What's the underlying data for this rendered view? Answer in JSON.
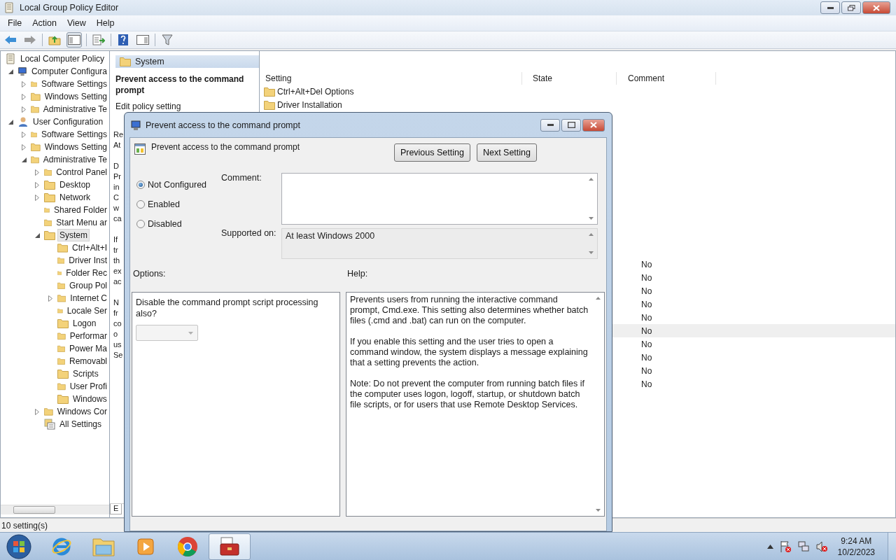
{
  "window": {
    "title": "Local Group Policy Editor"
  },
  "menu": [
    "File",
    "Action",
    "View",
    "Help"
  ],
  "tree": [
    {
      "label": "Local Computer Policy",
      "kind": "root",
      "selected": false,
      "children": [
        {
          "label": "Computer Configura",
          "kind": "computer",
          "expandable": true,
          "expanded": true,
          "selected": false,
          "children": [
            {
              "label": "Software Settings",
              "kind": "folder",
              "expandable": true,
              "expanded": false,
              "selected": false
            },
            {
              "label": "Windows Setting",
              "kind": "folder",
              "expandable": true,
              "expanded": false,
              "selected": false
            },
            {
              "label": "Administrative Te",
              "kind": "folder",
              "expandable": true,
              "expanded": false,
              "selected": false
            }
          ]
        },
        {
          "label": "User Configuration",
          "kind": "user",
          "expandable": true,
          "expanded": true,
          "selected": false,
          "children": [
            {
              "label": "Software Settings",
              "kind": "folder",
              "expandable": true,
              "expanded": false,
              "selected": false
            },
            {
              "label": "Windows Setting",
              "kind": "folder",
              "expandable": true,
              "expanded": false,
              "selected": false
            },
            {
              "label": "Administrative Te",
              "kind": "folder",
              "expandable": true,
              "expanded": true,
              "selected": false,
              "children": [
                {
                  "label": "Control Panel",
                  "kind": "folder",
                  "expandable": true,
                  "expanded": false,
                  "selected": false
                },
                {
                  "label": "Desktop",
                  "kind": "folder",
                  "expandable": true,
                  "expanded": false,
                  "selected": false
                },
                {
                  "label": "Network",
                  "kind": "folder",
                  "expandable": true,
                  "expanded": false,
                  "selected": false
                },
                {
                  "label": "Shared Folder",
                  "kind": "folder",
                  "expandable": false,
                  "expanded": false,
                  "selected": false
                },
                {
                  "label": "Start Menu ar",
                  "kind": "folder",
                  "expandable": false,
                  "expanded": false,
                  "selected": false
                },
                {
                  "label": "System",
                  "kind": "folder",
                  "expandable": true,
                  "expanded": true,
                  "selected": true,
                  "children": [
                    {
                      "label": "Ctrl+Alt+I",
                      "kind": "folder",
                      "expandable": false,
                      "expanded": false,
                      "selected": false
                    },
                    {
                      "label": "Driver Inst",
                      "kind": "folder",
                      "expandable": false,
                      "expanded": false,
                      "selected": false
                    },
                    {
                      "label": "Folder Rec",
                      "kind": "folder",
                      "expandable": false,
                      "expanded": false,
                      "selected": false
                    },
                    {
                      "label": "Group Pol",
                      "kind": "folder",
                      "expandable": false,
                      "expanded": false,
                      "selected": false
                    },
                    {
                      "label": "Internet C",
                      "kind": "folder",
                      "expandable": true,
                      "expanded": false,
                      "selected": false
                    },
                    {
                      "label": "Locale Ser",
                      "kind": "folder",
                      "expandable": false,
                      "expanded": false,
                      "selected": false
                    },
                    {
                      "label": "Logon",
                      "kind": "folder",
                      "expandable": false,
                      "expanded": false,
                      "selected": false
                    },
                    {
                      "label": "Performar",
                      "kind": "folder",
                      "expandable": false,
                      "expanded": false,
                      "selected": false
                    },
                    {
                      "label": "Power Ma",
                      "kind": "folder",
                      "expandable": false,
                      "expanded": false,
                      "selected": false
                    },
                    {
                      "label": "Removabl",
                      "kind": "folder",
                      "expandable": false,
                      "expanded": false,
                      "selected": false
                    },
                    {
                      "label": "Scripts",
                      "kind": "folder",
                      "expandable": false,
                      "expanded": false,
                      "selected": false
                    },
                    {
                      "label": "User Profi",
                      "kind": "folder",
                      "expandable": false,
                      "expanded": false,
                      "selected": false
                    },
                    {
                      "label": "Windows",
                      "kind": "folder",
                      "expandable": false,
                      "expanded": false,
                      "selected": false
                    }
                  ]
                },
                {
                  "label": "Windows Cor",
                  "kind": "folder",
                  "expandable": true,
                  "expanded": false,
                  "selected": false
                },
                {
                  "label": "All Settings",
                  "kind": "all",
                  "expandable": false,
                  "expanded": false,
                  "selected": false
                }
              ]
            }
          ]
        }
      ]
    }
  ],
  "details": {
    "header": "System",
    "title": "Prevent access to the command prompt",
    "edit_link": "Edit policy setting",
    "fragments": [
      [
        "Re",
        "At"
      ],
      [
        "D",
        "Pr",
        "in",
        "C",
        "w",
        "ca"
      ],
      [
        "If",
        "tr",
        "th",
        "ex",
        "ac"
      ],
      [
        "N",
        "fr",
        "co",
        "o",
        "us",
        "Se"
      ]
    ],
    "tabs": [
      {
        "label": "E",
        "selected": true
      }
    ]
  },
  "list": {
    "columns": [
      "Setting",
      "State",
      "Comment"
    ],
    "folders": [
      "Ctrl+Alt+Del Options",
      "Driver Installation"
    ],
    "settings": [
      {
        "comment": "No",
        "selected": false
      },
      {
        "comment": "No",
        "selected": false
      },
      {
        "comment": "No",
        "selected": false
      },
      {
        "comment": "No",
        "selected": false
      },
      {
        "comment": "No",
        "selected": false
      },
      {
        "comment": "No",
        "selected": true
      },
      {
        "comment": "No",
        "selected": false
      },
      {
        "comment": "No",
        "selected": false
      },
      {
        "comment": "No",
        "selected": false
      },
      {
        "comment": "No",
        "selected": false
      }
    ]
  },
  "status_bar": "10 setting(s)",
  "dialog": {
    "title": "Prevent access to the command prompt",
    "heading": "Prevent access to the command prompt",
    "buttons": [
      "Previous Setting",
      "Next Setting"
    ],
    "states": [
      {
        "label": "Not Configured",
        "selected": true
      },
      {
        "label": "Enabled",
        "selected": false
      },
      {
        "label": "Disabled",
        "selected": false
      }
    ],
    "comment_label": "Comment:",
    "supported_label": "Supported on:",
    "supported": "At least Windows 2000",
    "options_label": "Options:",
    "help_label": "Help:",
    "option": {
      "text": "Disable the command prompt script processing also?",
      "disabled": true
    },
    "help": [
      "Prevents users from running the interactive command prompt, Cmd.exe. This setting also determines whether batch files (.cmd and .bat) can run on the computer.",
      "If you enable this setting and the user tries to open a command window, the system displays a message explaining that a setting prevents the action.",
      "Note: Do not prevent the computer from running batch files if the computer uses logon, logoff, startup, or shutdown batch file scripts, or for users that use Remote Desktop Services."
    ]
  },
  "taskbar": {
    "apps": [
      {
        "kind": "browser",
        "active": false
      },
      {
        "kind": "explorer",
        "active": false
      },
      {
        "kind": "media",
        "active": false
      },
      {
        "kind": "chrome",
        "active": false
      },
      {
        "kind": "toolbox",
        "active": true
      }
    ],
    "clock": {
      "time": "9:24 AM",
      "date": "10/2/2023"
    }
  }
}
